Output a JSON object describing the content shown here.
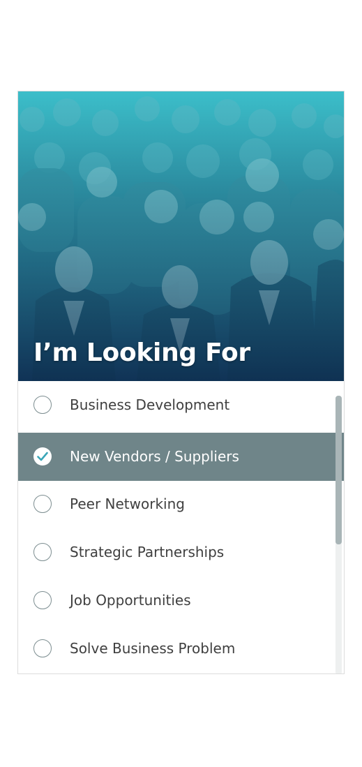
{
  "hero": {
    "title": "I’m Looking For",
    "image": "crowd-of-business-people-photo"
  },
  "options": [
    {
      "label": "Business Development",
      "selected": false
    },
    {
      "label": "New Vendors / Suppliers",
      "selected": true
    },
    {
      "label": "Peer Networking",
      "selected": false
    },
    {
      "label": "Strategic Partnerships",
      "selected": false
    },
    {
      "label": "Job Opportunities",
      "selected": false
    },
    {
      "label": "Solve Business Problem",
      "selected": false
    }
  ],
  "icons": {
    "unchecked": "radio-empty-icon",
    "checked": "checkmark-icon"
  },
  "colors": {
    "selected_row": "#6f8589",
    "check_color": "#3aa6b8",
    "text": "#3f3f3f"
  }
}
